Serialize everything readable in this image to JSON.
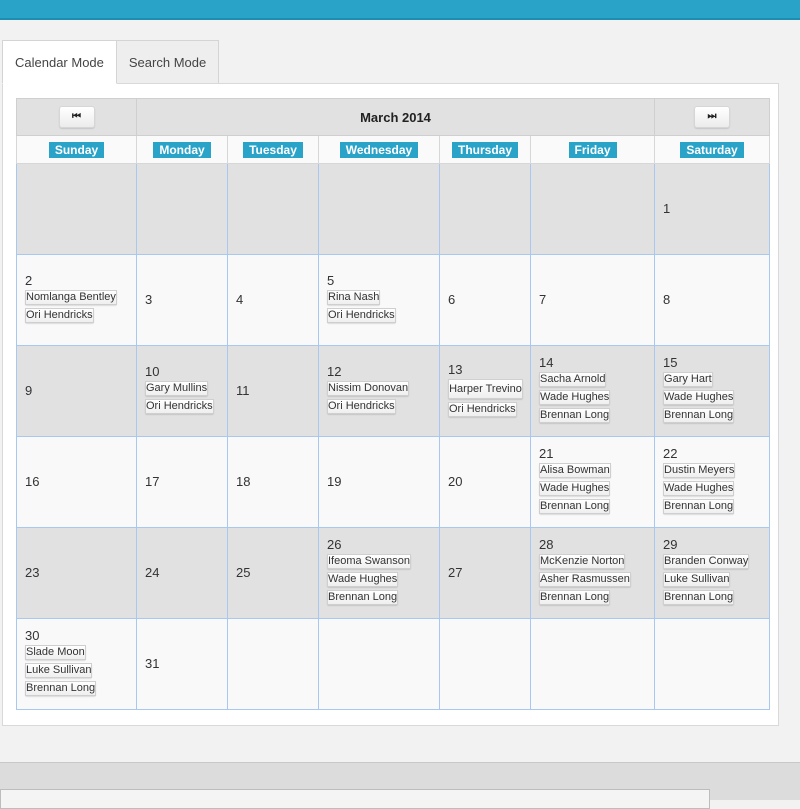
{
  "header": {
    "title": ""
  },
  "tabs": [
    {
      "label": "Calendar Mode",
      "active": true
    },
    {
      "label": "Search Mode",
      "active": false
    }
  ],
  "calendar": {
    "month_title": "March 2014",
    "prev_icon": "skip-previous-icon",
    "next_icon": "skip-next-icon",
    "prev_glyph": "⏮",
    "next_glyph": "⏭",
    "days_of_week": [
      "Sunday",
      "Monday",
      "Tuesday",
      "Wednesday",
      "Thursday",
      "Friday",
      "Saturday"
    ],
    "weeks": [
      [
        {
          "day": "",
          "appointments": []
        },
        {
          "day": "",
          "appointments": []
        },
        {
          "day": "",
          "appointments": []
        },
        {
          "day": "",
          "appointments": []
        },
        {
          "day": "",
          "appointments": []
        },
        {
          "day": "",
          "appointments": []
        },
        {
          "day": "1",
          "appointments": []
        }
      ],
      [
        {
          "day": "2",
          "appointments": [
            "Nomlanga Bentley",
            "Ori Hendricks"
          ]
        },
        {
          "day": "3",
          "appointments": []
        },
        {
          "day": "4",
          "appointments": []
        },
        {
          "day": "5",
          "appointments": [
            "Rina Nash",
            "Ori Hendricks"
          ]
        },
        {
          "day": "6",
          "appointments": []
        },
        {
          "day": "7",
          "appointments": []
        },
        {
          "day": "8",
          "appointments": []
        }
      ],
      [
        {
          "day": "9",
          "appointments": []
        },
        {
          "day": "10",
          "appointments": [
            "Gary Mullins",
            "Ori Hendricks"
          ]
        },
        {
          "day": "11",
          "appointments": []
        },
        {
          "day": "12",
          "appointments": [
            "Nissim Donovan",
            "Ori Hendricks"
          ]
        },
        {
          "day": "13",
          "appointments": [
            "Harper Trevino",
            "Ori Hendricks"
          ]
        },
        {
          "day": "14",
          "appointments": [
            "Sacha Arnold",
            "Wade Hughes",
            "Brennan Long"
          ]
        },
        {
          "day": "15",
          "appointments": [
            "Gary Hart",
            "Wade Hughes",
            "Brennan Long"
          ]
        }
      ],
      [
        {
          "day": "16",
          "appointments": []
        },
        {
          "day": "17",
          "appointments": []
        },
        {
          "day": "18",
          "appointments": []
        },
        {
          "day": "19",
          "appointments": []
        },
        {
          "day": "20",
          "appointments": []
        },
        {
          "day": "21",
          "appointments": [
            "Alisa Bowman",
            "Wade Hughes",
            "Brennan Long"
          ]
        },
        {
          "day": "22",
          "appointments": [
            "Dustin Meyers",
            "Wade Hughes",
            "Brennan Long"
          ]
        }
      ],
      [
        {
          "day": "23",
          "appointments": []
        },
        {
          "day": "24",
          "appointments": []
        },
        {
          "day": "25",
          "appointments": []
        },
        {
          "day": "26",
          "appointments": [
            "Ifeoma Swanson",
            "Wade Hughes",
            "Brennan Long"
          ]
        },
        {
          "day": "27",
          "appointments": []
        },
        {
          "day": "28",
          "appointments": [
            "McKenzie Norton",
            "Asher Rasmussen",
            "Brennan Long"
          ]
        },
        {
          "day": "29",
          "appointments": [
            "Branden Conway",
            "Luke Sullivan",
            "Brennan Long"
          ]
        }
      ],
      [
        {
          "day": "30",
          "appointments": [
            "Slade Moon",
            "Luke Sullivan",
            "Brennan Long"
          ]
        },
        {
          "day": "31",
          "appointments": []
        },
        {
          "day": "",
          "appointments": []
        },
        {
          "day": "",
          "appointments": []
        },
        {
          "day": "",
          "appointments": []
        },
        {
          "day": "",
          "appointments": []
        },
        {
          "day": "",
          "appointments": []
        }
      ]
    ]
  },
  "colors": {
    "accent": "#2aa3c9",
    "cell_border": "#a8c8f0",
    "shaded_row": "#e1e1e1",
    "plain_row": "#f9f9f9"
  }
}
